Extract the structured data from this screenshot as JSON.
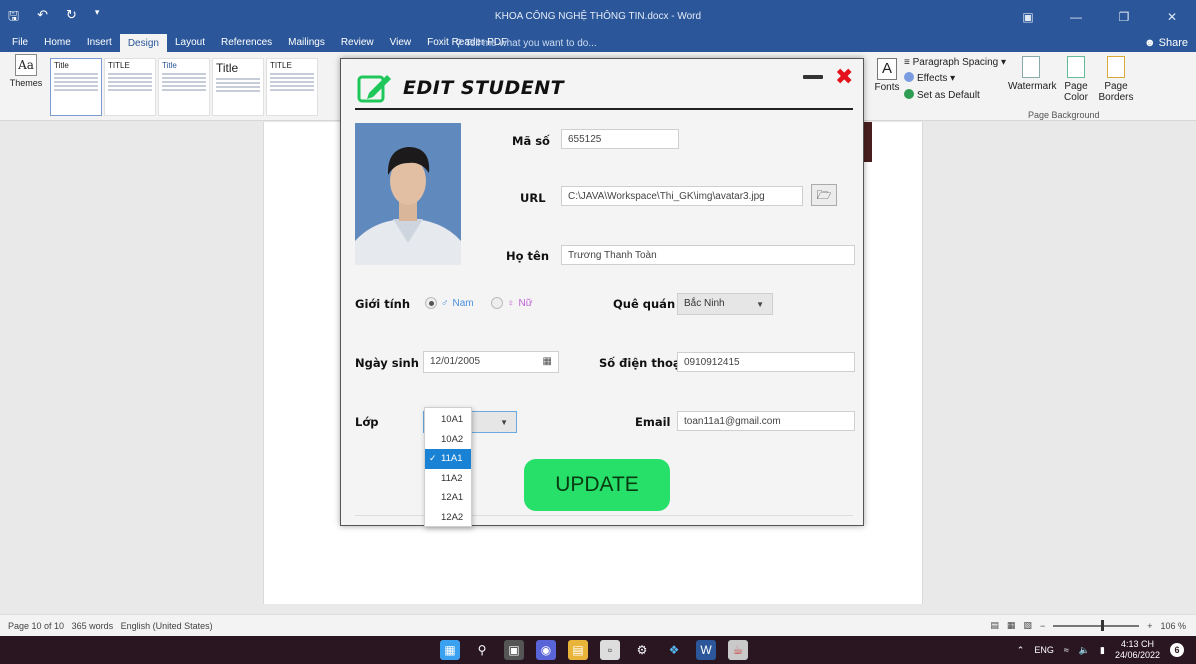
{
  "word": {
    "title": "KHOA CÔNG NGHỆ THÔNG TIN.docx - Word",
    "tabs": [
      "File",
      "Home",
      "Insert",
      "Design",
      "Layout",
      "References",
      "Mailings",
      "Review",
      "View",
      "Foxit Reader PDF"
    ],
    "active_tab": "Design",
    "tell_me": "Tell me what you want to do...",
    "share": "Share",
    "themes_label": "Themes",
    "style_thumbs": [
      "Title",
      "TITLE",
      "Title",
      "Title",
      "TITLE"
    ],
    "fonts_label": "Fonts",
    "paragraph_spacing": "Paragraph Spacing",
    "effects": "Effects",
    "set_as_default": "Set as Default",
    "watermark": "Watermark",
    "page_color": "Page Color",
    "page_borders": "Page Borders",
    "page_background_group": "Page Background",
    "status": {
      "page": "Page 10 of 10",
      "words": "365 words",
      "language": "English (United States)",
      "zoom": "106 %"
    }
  },
  "dialog": {
    "title": "EDIT STUDENT",
    "fields": {
      "ma_so_label": "Mã số",
      "ma_so_value": "655125",
      "url_label": "URL",
      "url_value": "C:\\JAVA\\Workspace\\Thi_GK\\img\\avatar3.jpg",
      "ho_ten_label": "Họ tên",
      "ho_ten_value": "Trương Thanh Toàn",
      "gioi_tinh_label": "Giới tính",
      "gender_male": "Nam",
      "gender_female": "Nữ",
      "gender_selected": "Nam",
      "que_quan_label": "Quê quán",
      "que_quan_value": "Bắc Ninh",
      "ngay_sinh_label": "Ngày sinh",
      "ngay_sinh_value": "12/01/2005",
      "sdt_label": "Số điện thoại",
      "sdt_value": "0910912415",
      "lop_label": "Lớp",
      "email_label": "Email",
      "email_value": "toan11a1@gmail.com"
    },
    "lop_options": [
      "10A1",
      "10A2",
      "11A1",
      "11A2",
      "12A1",
      "12A2"
    ],
    "lop_selected": "11A1",
    "update_label": "UPDATE",
    "colors": {
      "update": "#26e06a",
      "close": "#e3121b",
      "selection": "#1a82d4"
    }
  },
  "taskbar": {
    "lang": "ENG",
    "time": "4:13 CH",
    "date": "24/06/2022",
    "notifications": "6"
  }
}
